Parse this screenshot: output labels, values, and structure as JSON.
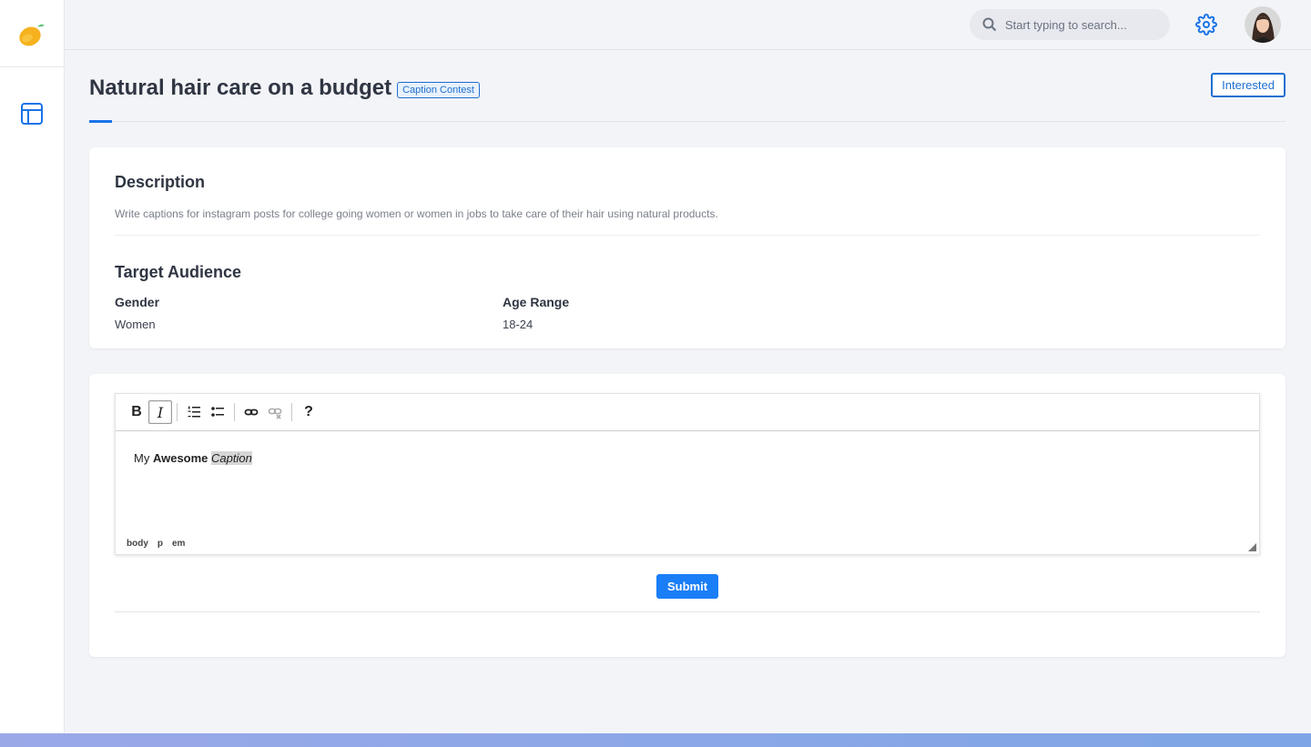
{
  "colors": {
    "accent": "#1a73e8",
    "submit": "#1a7ef7",
    "logo": "#f6b21e"
  },
  "sidebar": {
    "logo_icon": "mango-icon",
    "items": [
      {
        "icon": "layout-icon"
      }
    ]
  },
  "topbar": {
    "search_placeholder": "Start typing to search...",
    "settings_icon": "gear-icon"
  },
  "page": {
    "title": "Natural hair care on a budget",
    "badge": "Caption Contest",
    "interested_label": "Interested"
  },
  "description": {
    "heading": "Description",
    "text": "Write captions for instagram posts for college going women or women in jobs to take care of their hair using natural products."
  },
  "target_audience": {
    "heading": "Target Audience",
    "gender_label": "Gender",
    "gender_value": "Women",
    "age_label": "Age Range",
    "age_value": "18-24"
  },
  "editor": {
    "toolbar": {
      "bold": "B",
      "italic": "I",
      "help": "?"
    },
    "content": {
      "plain": "My ",
      "bold": "Awesome",
      "italic": "Caption"
    },
    "path": [
      "body",
      "p",
      "em"
    ]
  },
  "submit_label": "Submit"
}
